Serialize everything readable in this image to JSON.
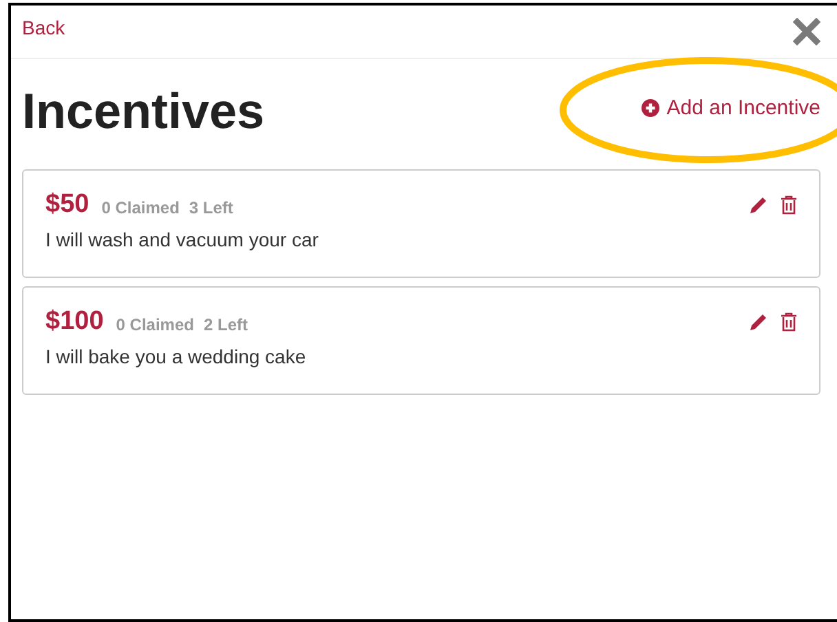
{
  "header": {
    "back_link": "Back"
  },
  "title": "Incentives",
  "add_link": {
    "label": "Add an Incentive",
    "highlighted": true
  },
  "incentives": [
    {
      "amount": "$50",
      "claimed": "0 Claimed",
      "left": "3 Left",
      "description": "I will wash and vacuum your car"
    },
    {
      "amount": "$100",
      "claimed": "0 Claimed",
      "left": "2 Left",
      "description": "I will bake you a wedding cake"
    }
  ]
}
